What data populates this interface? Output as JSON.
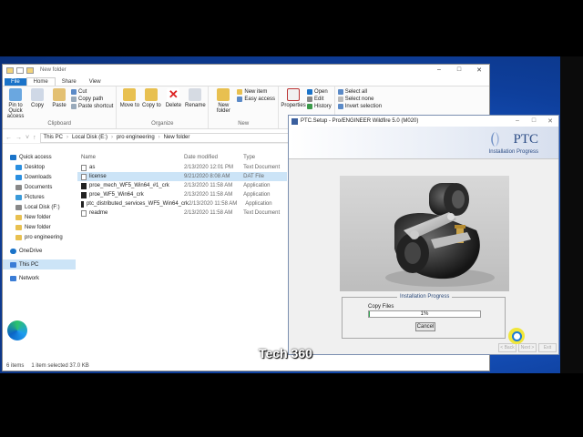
{
  "explorer": {
    "title": "New folder",
    "tabs": [
      "File",
      "Home",
      "Share",
      "View"
    ],
    "ribbon": {
      "clipboard": {
        "label": "Clipboard",
        "pin": "Pin to Quick access",
        "copy": "Copy",
        "paste": "Paste",
        "cut": "Cut",
        "copy_path": "Copy path",
        "paste_shortcut": "Paste shortcut"
      },
      "organize": {
        "label": "Organize",
        "move_to": "Move to",
        "copy_to": "Copy to",
        "delete": "Delete",
        "rename": "Rename"
      },
      "new": {
        "label": "New",
        "new_folder": "New folder",
        "new_item": "New item",
        "easy_access": "Easy access"
      },
      "open": {
        "properties": "Properties",
        "open": "Open",
        "edit": "Edit",
        "history": "History"
      },
      "select": {
        "select_all": "Select all",
        "select_none": "Select none",
        "invert": "Invert selection"
      }
    },
    "path": [
      "This PC",
      "Local Disk (E:)",
      "pro engineering",
      "New folder"
    ],
    "nav": [
      {
        "label": "Quick access",
        "color": "#1a73c9"
      },
      {
        "label": "Desktop",
        "color": "#2a8fe0"
      },
      {
        "label": "Downloads",
        "color": "#2a8fe0"
      },
      {
        "label": "Documents",
        "color": "#888"
      },
      {
        "label": "Pictures",
        "color": "#3a9ad9"
      },
      {
        "label": "Local Disk (F:)",
        "color": "#888"
      },
      {
        "label": "New folder",
        "color": "#e8c050"
      },
      {
        "label": "New folder",
        "color": "#e8c050"
      },
      {
        "label": "pro engineering",
        "color": "#e8c050"
      },
      {
        "label": "OneDrive",
        "color": "#1a73c9"
      },
      {
        "label": "This PC",
        "color": "#3a7dd6"
      },
      {
        "label": "Network",
        "color": "#3a7dd6"
      }
    ],
    "columns": [
      "Name",
      "Date modified",
      "Type"
    ],
    "files": [
      {
        "name": "as",
        "date": "2/13/2020 12:01 PM",
        "type": "Text Document",
        "app": false
      },
      {
        "name": "license",
        "date": "9/21/2020 8:08 AM",
        "type": "DAT File",
        "app": false
      },
      {
        "name": "proe_mech_WF5_Win64_#1_crk",
        "date": "2/13/2020 11:58 AM",
        "type": "Application",
        "app": true
      },
      {
        "name": "proe_WF5_Win64_crk",
        "date": "2/13/2020 11:58 AM",
        "type": "Application",
        "app": true
      },
      {
        "name": "ptc_distributed_services_WF5_Win64_crk",
        "date": "2/13/2020 11:58 AM",
        "type": "Application",
        "app": true
      },
      {
        "name": "readme",
        "date": "2/13/2020 11:58 AM",
        "type": "Text Document",
        "app": false
      }
    ],
    "status": {
      "items": "6 items",
      "selected": "1 item selected 37.0 KB"
    }
  },
  "setup": {
    "title": "PTC.Setup - Pro/ENGINEER Wildfire 5.0 (M020)",
    "logo": "PTC",
    "subtitle": "Installation Progress",
    "progress_legend": "Installation Progress",
    "step": "Copy Files",
    "percent": 1,
    "percent_label": "1%",
    "cancel": "Cancel",
    "back": "< Back",
    "next": "Next >",
    "exit": "Exit"
  },
  "desktop": {
    "edge_label": "Microsoft Edge",
    "watermark": "Tech 360"
  }
}
